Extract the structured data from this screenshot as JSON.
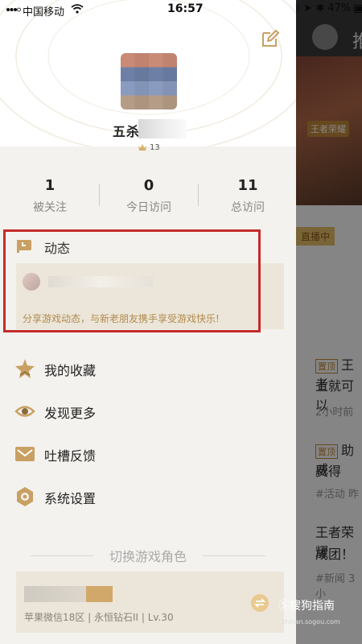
{
  "status_bar": {
    "carrier": "中国移动",
    "time": "16:57",
    "battery": "47%"
  },
  "profile": {
    "nickname": "五杀",
    "level": "13"
  },
  "stats": [
    {
      "value": "1",
      "label": "被关注"
    },
    {
      "value": "0",
      "label": "今日访问"
    },
    {
      "value": "11",
      "label": "总访问"
    }
  ],
  "moments": {
    "title": "动态",
    "promo": "分享游戏动态，与新老朋友携手享受游戏快乐!"
  },
  "menu": [
    {
      "label": "我的收藏",
      "icon": "star-icon"
    },
    {
      "label": "发现更多",
      "icon": "eye-icon"
    },
    {
      "label": "吐槽反馈",
      "icon": "mail-icon"
    },
    {
      "label": "系统设置",
      "icon": "settings-icon"
    }
  ],
  "switch_role": {
    "title": "切换游戏角色",
    "info": "苹果微信18区 | 永恒钻石II | Lv.30"
  },
  "background_page": {
    "header_title": "推",
    "banner_tag": "王者荣耀",
    "live_tag": "直播中",
    "news": [
      {
        "tag": "置顶",
        "line1": "王者",
        "line2": "上就可以",
        "meta": "2小时前"
      },
      {
        "tag": "置顶",
        "line1": "助威",
        "line2": "费得",
        "meta": "#活动  昨"
      },
      {
        "tag": "",
        "line1": "王者荣耀",
        "line2": "成团！",
        "meta": "#新闻  3小"
      }
    ]
  },
  "watermark": {
    "text": "搜狗指南",
    "sub": "zhinan.sogou.com"
  },
  "colors": {
    "accent_gold": "#c9a063",
    "highlight_red": "#c42b2b",
    "panel_bg": "#f4f2ee"
  }
}
